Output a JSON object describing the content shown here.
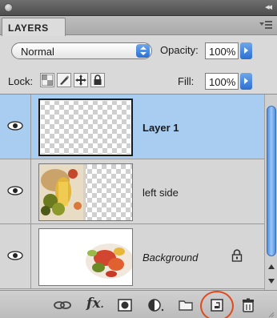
{
  "panel": {
    "tab_label": "LAYERS",
    "blend_mode": "Normal",
    "opacity_label": "Opacity:",
    "opacity_value": "100%",
    "lock_label": "Lock:",
    "fill_label": "Fill:",
    "fill_value": "100%"
  },
  "layers": [
    {
      "name": "Layer 1",
      "visible": true,
      "selected": true,
      "style": "bold",
      "thumbnail": "transparent-empty"
    },
    {
      "name": "left side",
      "visible": true,
      "selected": false,
      "style": "normal",
      "thumbnail": "food-photo-left-half"
    },
    {
      "name": "Background",
      "visible": true,
      "selected": false,
      "style": "italic",
      "locked": true,
      "thumbnail": "food-photo-plate"
    }
  ],
  "bottom_icons": [
    "link-layers-icon",
    "fx-icon",
    "layer-mask-icon",
    "adjustment-layer-icon",
    "folder-icon",
    "new-layer-icon",
    "trash-icon"
  ],
  "colors": {
    "selected_row": "#a8cdf0",
    "accent_blue": "#2c6fd1",
    "highlight_circle": "#e04a1a"
  }
}
